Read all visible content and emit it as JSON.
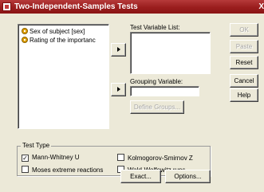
{
  "window": {
    "title": "Two-Independent-Samples Tests",
    "close": "X"
  },
  "source_list": {
    "items": [
      {
        "label": "Sex of subject [sex]"
      },
      {
        "label": "Rating of the importanc"
      }
    ]
  },
  "test_variable": {
    "label": "Test Variable List:"
  },
  "grouping_variable": {
    "label": "Grouping Variable:",
    "value": ""
  },
  "buttons": {
    "define_groups": "Define Groups...",
    "ok": "OK",
    "paste": "Paste",
    "reset": "Reset",
    "cancel": "Cancel",
    "help": "Help",
    "exact": "Exact...",
    "options": "Options..."
  },
  "test_type": {
    "title": "Test Type",
    "mann_whitney": {
      "label": "Mann-Whitney U",
      "checked": true
    },
    "kolmogorov": {
      "label": "Kolmogorov-Smirnov Z",
      "checked": false
    },
    "moses": {
      "label": "Moses extreme reactions",
      "checked": false
    },
    "wald": {
      "label": "Wald-Wolfowitz runs",
      "checked": false
    }
  }
}
